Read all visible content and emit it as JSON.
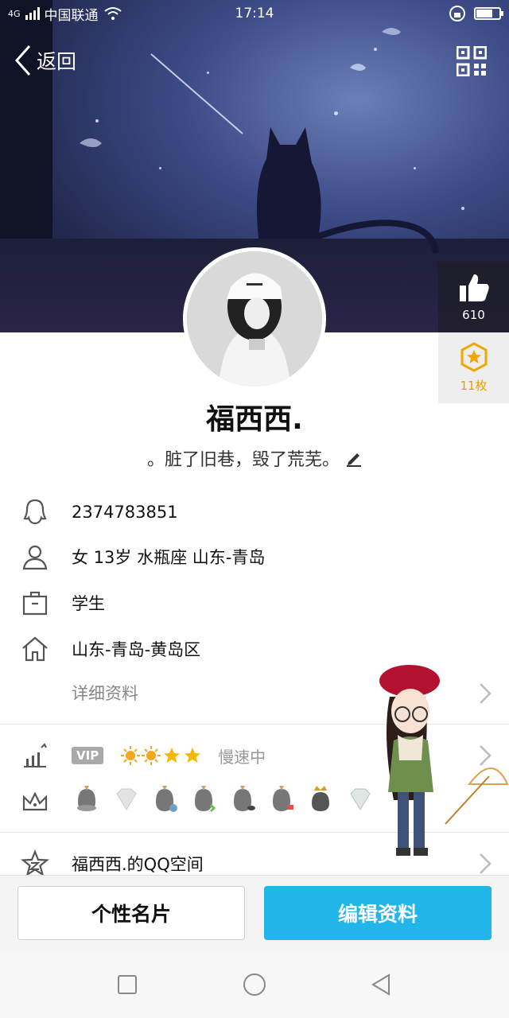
{
  "status_bar": {
    "network": "4G",
    "carrier": "中国联通",
    "time": "17:14",
    "battery_level": 0.7
  },
  "header": {
    "back_label": "返回",
    "qr_icon": "qr-code-icon"
  },
  "likes": {
    "count": "610",
    "icon": "thumbs-up-icon"
  },
  "medals": {
    "label": "11枚",
    "icon": "star-medal-icon",
    "color": "#f0a800"
  },
  "profile": {
    "nickname": "福西西.",
    "signature": "。脏了旧巷，毁了荒芜。"
  },
  "info": {
    "qq_number": "2374783851",
    "personal": "女  13岁  水瓶座  山东-青岛",
    "occupation": "学生",
    "hometown": "山东-青岛-黄岛区",
    "detail_link": "详细资料"
  },
  "vip_row": {
    "badge": "VIP",
    "speed": "慢速中",
    "sun_count": 2,
    "star_count": 2
  },
  "qzone": {
    "label": "福西西.的QQ空间"
  },
  "actions": {
    "card_label": "个性名片",
    "edit_label": "编辑资料",
    "accent": "#20b6ea"
  }
}
